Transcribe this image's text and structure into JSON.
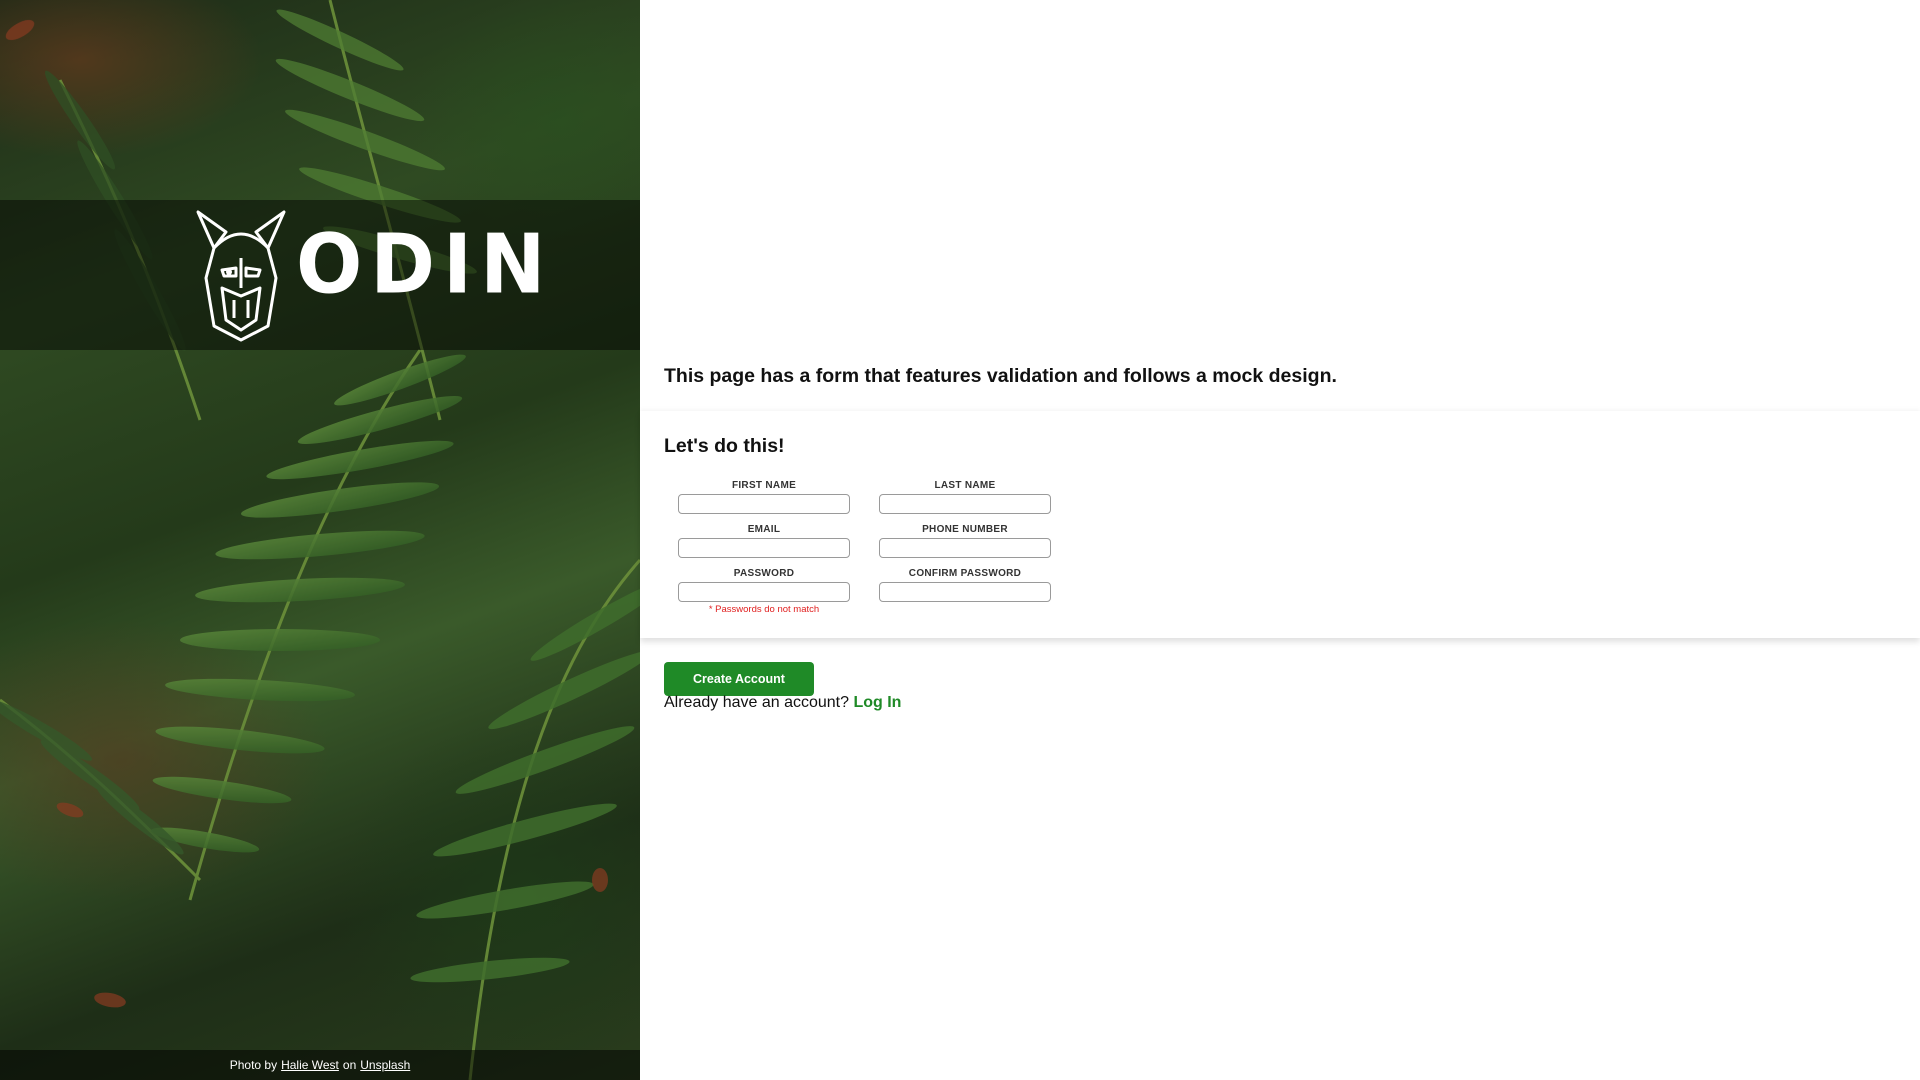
{
  "hero": {
    "brand_name": "ODIN",
    "credit_prefix": "Photo by",
    "credit_author": "Halie West",
    "credit_middle": "on",
    "credit_source": "Unsplash"
  },
  "content": {
    "intro": "This page has a form that features validation and follows a mock design.",
    "form_title": "Let's do this!",
    "fields": {
      "first_name": {
        "label": "FIRST NAME",
        "value": ""
      },
      "last_name": {
        "label": "LAST NAME",
        "value": ""
      },
      "email": {
        "label": "EMAIL",
        "value": ""
      },
      "phone": {
        "label": "PHONE NUMBER",
        "value": ""
      },
      "password": {
        "label": "PASSWORD",
        "value": "",
        "error": "* Passwords do not match"
      },
      "confirm_password": {
        "label": "CONFIRM PASSWORD",
        "value": ""
      }
    },
    "create_button": "Create Account",
    "login_prompt": "Already have an account?",
    "login_link": "Log In"
  },
  "colors": {
    "accent_green": "#1f8a27",
    "error_red": "#e02020"
  }
}
